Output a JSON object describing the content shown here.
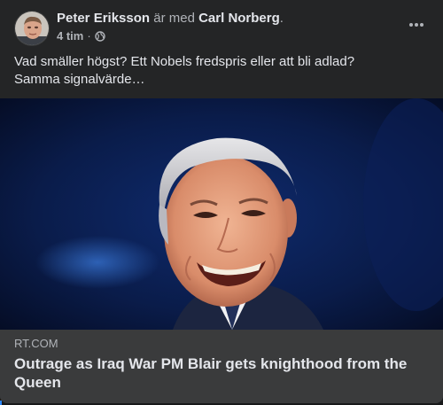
{
  "post": {
    "author": "Peter Eriksson",
    "with_text": " är med ",
    "tagged": "Carl Norberg",
    "tagged_suffix": ".",
    "time": "4 tim",
    "separator": "·",
    "privacy_icon": "globe-icon",
    "more_icon": "more-horizontal-icon",
    "text_line1": "Vad smäller högst? Ett Nobels fredspris eller att bli adlad?",
    "text_line2": "Samma signalvärde…"
  },
  "link": {
    "domain": "RT.COM",
    "title": "Outrage as Iraq War PM Blair gets knighthood from the Queen"
  },
  "colors": {
    "card_bg": "#242526",
    "link_bg": "#3a3b3c",
    "primary_text": "#e4e6eb",
    "secondary_text": "#b0b3b8"
  }
}
